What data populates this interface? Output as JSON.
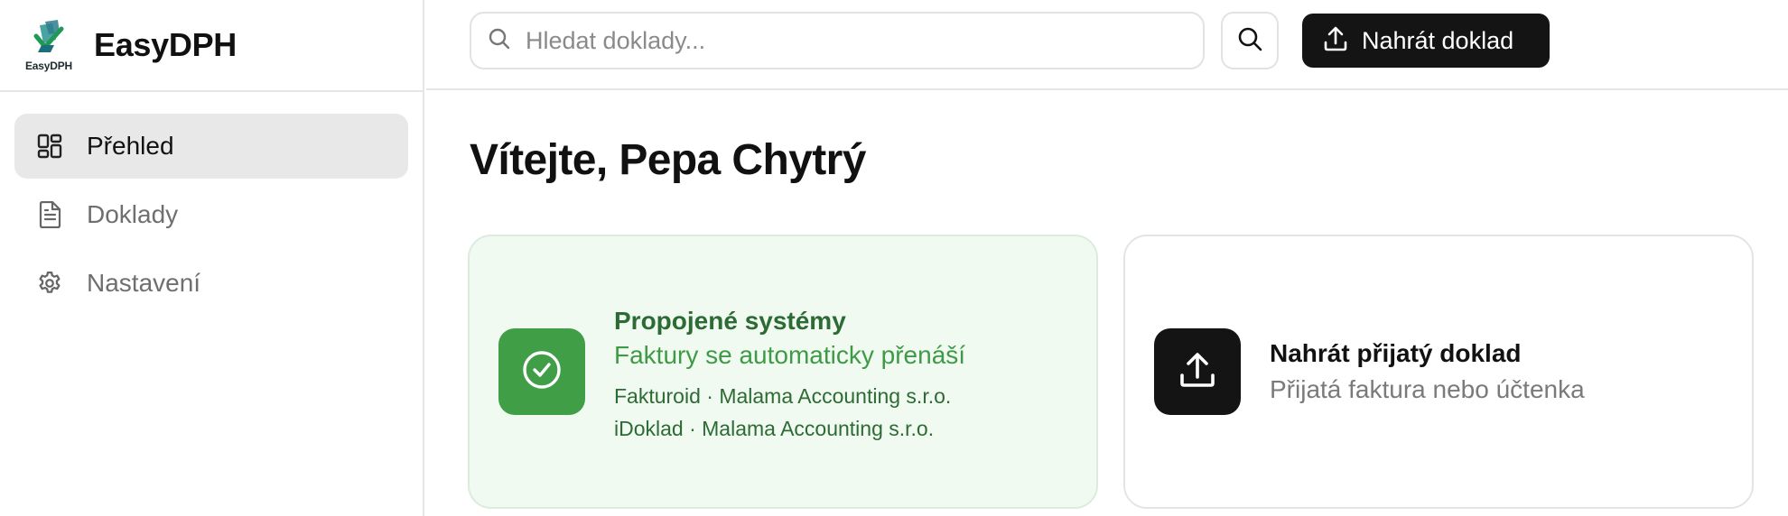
{
  "app": {
    "name": "EasyDPH",
    "logo_text": "EasyDPH"
  },
  "sidebar": {
    "items": [
      {
        "label": "Přehled",
        "icon": "dashboard-grid-icon",
        "active": true
      },
      {
        "label": "Doklady",
        "icon": "document-icon",
        "active": false
      },
      {
        "label": "Nastavení",
        "icon": "gear-icon",
        "active": false
      }
    ]
  },
  "header": {
    "search": {
      "placeholder": "Hledat doklady...",
      "value": ""
    },
    "upload_label": "Nahrát doklad"
  },
  "main": {
    "welcome": "Vítejte, Pepa Chytrý",
    "connected_card": {
      "title": "Propojené systémy",
      "subtitle": "Faktury se automaticky přenáší",
      "connections": [
        "Fakturoid · Malama Accounting s.r.o.",
        "iDoklad · Malama Accounting s.r.o."
      ]
    },
    "upload_card": {
      "title": "Nahrát přijatý doklad",
      "subtitle": "Přijatá faktura nebo účtenka"
    }
  },
  "colors": {
    "primary_dark": "#141414",
    "success_green": "#3f9e46",
    "success_bg": "#f0faf1",
    "active_nav_bg": "#e8e8e8"
  }
}
